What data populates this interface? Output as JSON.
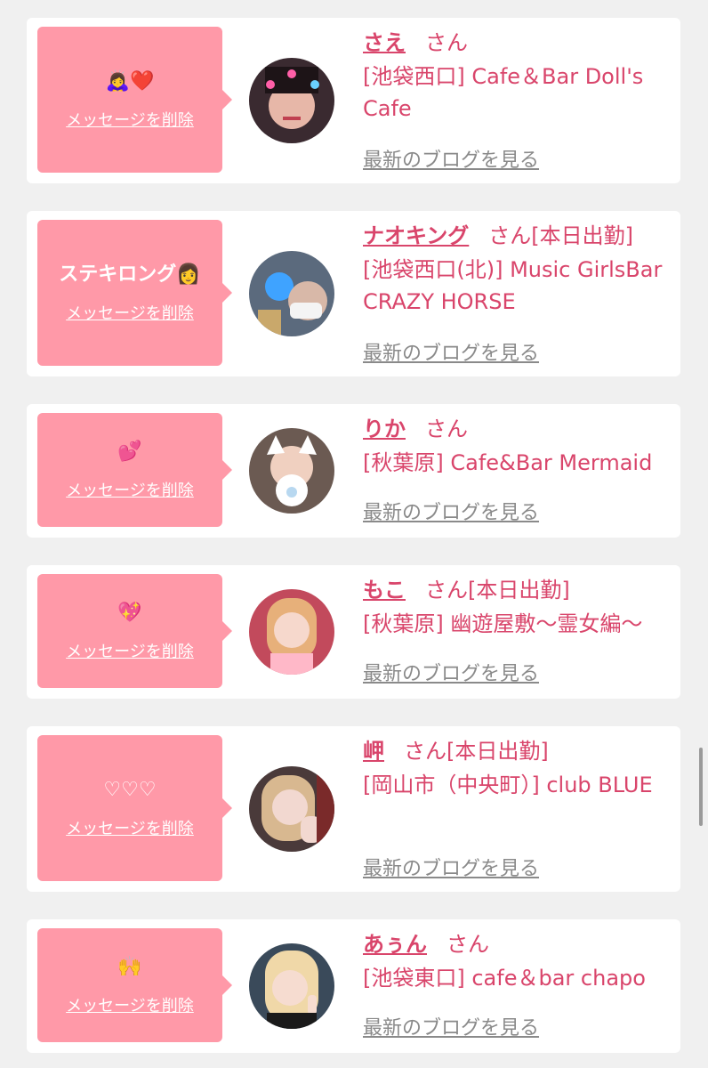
{
  "delete_label": "メッセージを削除",
  "blog_label": "最新のブログを見る",
  "entries": [
    {
      "message": "🙇‍♀️❤️",
      "name": "さえ",
      "suffix": "さん",
      "shop": "[池袋西口] Cafe＆Bar Doll's Cafe"
    },
    {
      "message": "ステキロング👩",
      "name": "ナオキング",
      "suffix": "さん[本日出勤]",
      "shop": "[池袋西口(北)] Music GirlsBar CRAZY HORSE"
    },
    {
      "message": "💕",
      "name": "りか",
      "suffix": "さん",
      "shop": "[秋葉原] Cafe&Bar Mermaid"
    },
    {
      "message": "💖",
      "name": "もこ",
      "suffix": "さん[本日出勤]",
      "shop": "[秋葉原] 幽遊屋敷〜霊女編〜"
    },
    {
      "message": "♡♡♡",
      "name": "岬",
      "suffix": "さん[本日出勤]",
      "shop": "[岡山市（中央町）] club BLUE"
    },
    {
      "message": "🙌",
      "name": "あぅん",
      "suffix": "さん",
      "shop": "[池袋東口] cafe＆bar chapo"
    }
  ],
  "colors": {
    "bubble": "#ff99a8",
    "accent": "#d9456b",
    "background": "#f0f0f0"
  }
}
